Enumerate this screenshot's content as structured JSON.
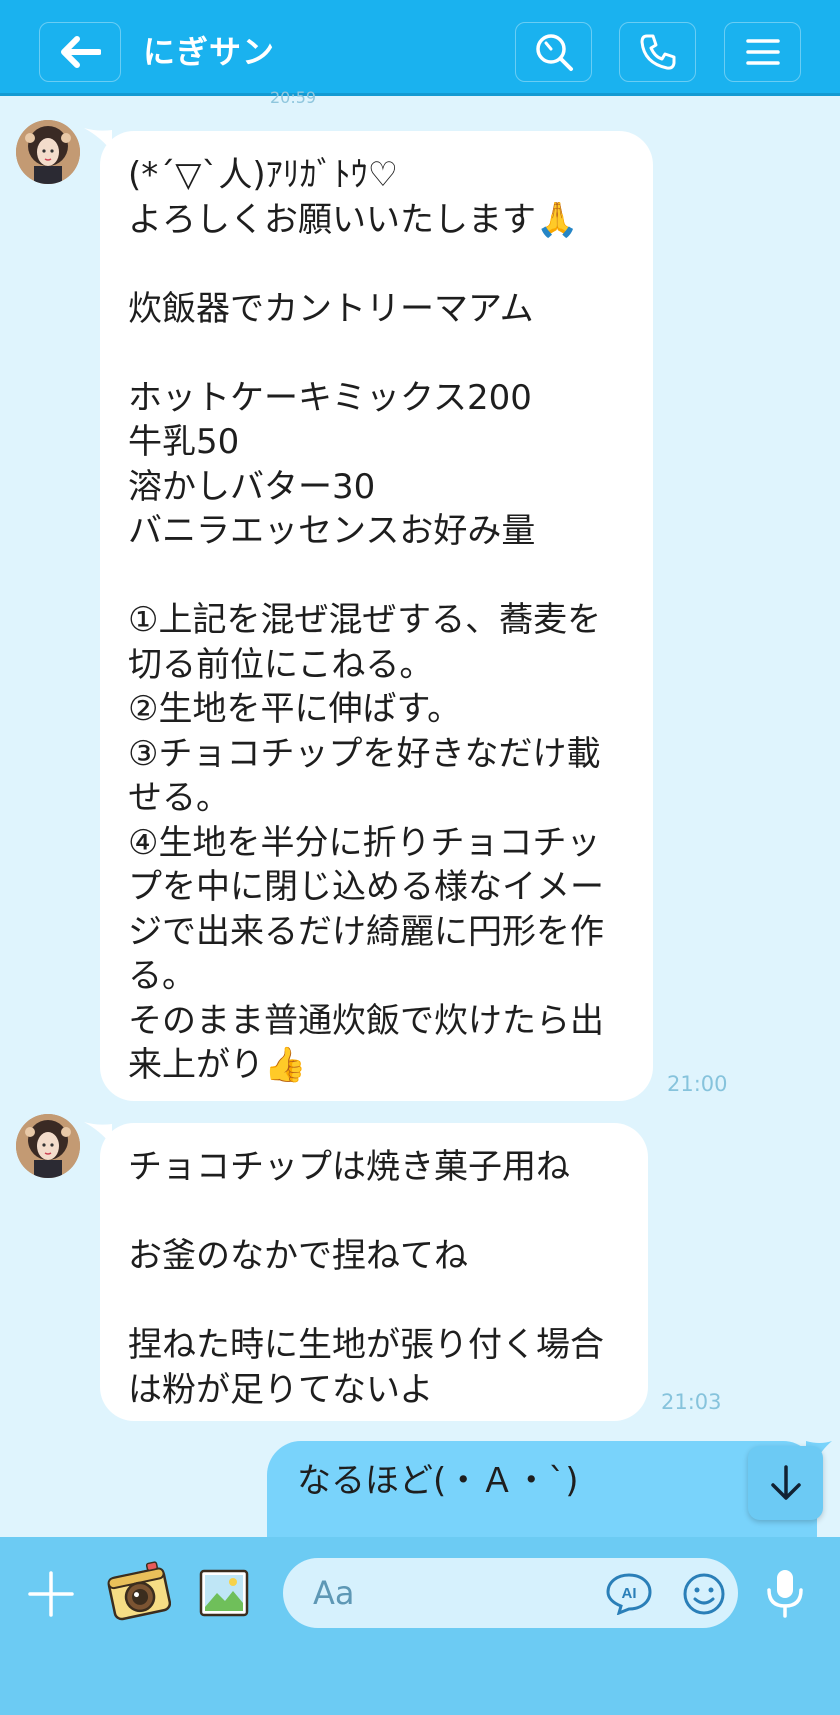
{
  "header": {
    "title": "にぎサン",
    "back_icon": "arrow-left-icon",
    "search_icon": "search-icon",
    "call_icon": "phone-icon",
    "menu_icon": "menu-icon"
  },
  "messages": [
    {
      "sender": "other",
      "text": "(*´▽`人)ｱﾘｶﾞﾄｳ♡\nよろしくお願いいたします🙏\n\n炊飯器でカントリーマアム\n\nホットケーキミックス200\n牛乳50\n溶かしバター30\nバニラエッセンスお好み量\n\n①上記を混ぜ混ぜする、蕎麦を\n切る前位にこねる。\n②生地を平に伸ばす。\n③チョコチップを好きなだけ載\nせる。\n④生地を半分に折りチョコチッ\nプを中に閉じ込める様なイメー\nジで出来るだけ綺麗に円形を作\nる。\nそのまま普通炊飯で炊けたら出\n来上がり👍",
      "time": "21:00"
    },
    {
      "sender": "other",
      "text": "チョコチップは焼き菓子用ね\n\nお釜のなかで捏ねてね\n\n捏ねた時に生地が張り付く場合\nは粉が足りてないよ",
      "time": "21:03"
    },
    {
      "sender": "me",
      "text": "なるほど(・Ａ・`)"
    }
  ],
  "input": {
    "placeholder": "Aa",
    "value": "",
    "plus_icon": "plus-icon",
    "camera_icon": "camera-icon",
    "image_icon": "image-icon",
    "ai_icon": "ai-icon",
    "emoji_icon": "emoji-icon",
    "mic_icon": "mic-icon",
    "ai_label": "AI"
  },
  "colors": {
    "header": "#1ab2ef",
    "background": "#dff4fd",
    "outgoing_bubble": "#79d3fb",
    "input_bar": "#6ccbf3",
    "timestamp": "#86c3dc"
  }
}
